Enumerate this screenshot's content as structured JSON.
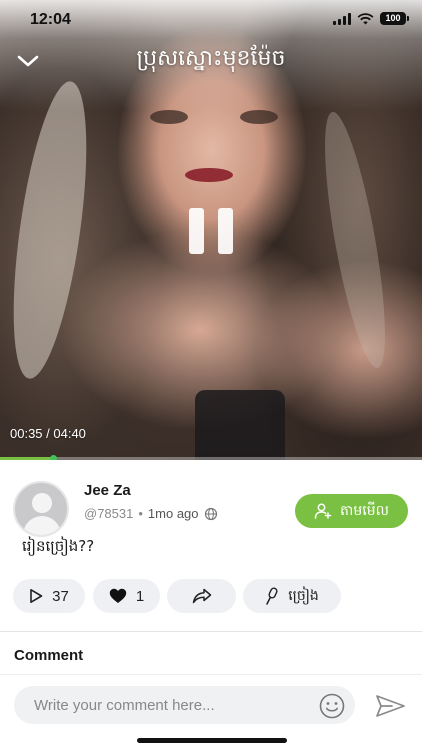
{
  "status_bar": {
    "time": "12:04",
    "battery": "100"
  },
  "video": {
    "title": "ប្រុសស្នោះមុខម៉ែច",
    "current_time": "00:35",
    "duration": "04:40",
    "time_readout": "00:35 / 04:40",
    "progress_fraction": 0.125
  },
  "author": {
    "name": "Jee Za",
    "handle": "@78531",
    "separator": "•",
    "posted": "1mo ago"
  },
  "follow_button": {
    "label": "តាមមើល"
  },
  "post": {
    "text": "រៀនច្រៀង??"
  },
  "actions": {
    "plays": "37",
    "likes": "1",
    "lyrics_label": "ច្រៀង"
  },
  "comments": {
    "heading": "Comment",
    "placeholder": "Write your comment here..."
  },
  "colors": {
    "accent": "#7ac143",
    "pill_bg": "#eef0f3"
  },
  "icons": [
    "chevron-down-icon",
    "pause-icon",
    "play-icon",
    "heart-icon",
    "share-icon",
    "microphone-icon",
    "user-follow-icon",
    "globe-icon",
    "emoji-icon",
    "send-icon"
  ]
}
